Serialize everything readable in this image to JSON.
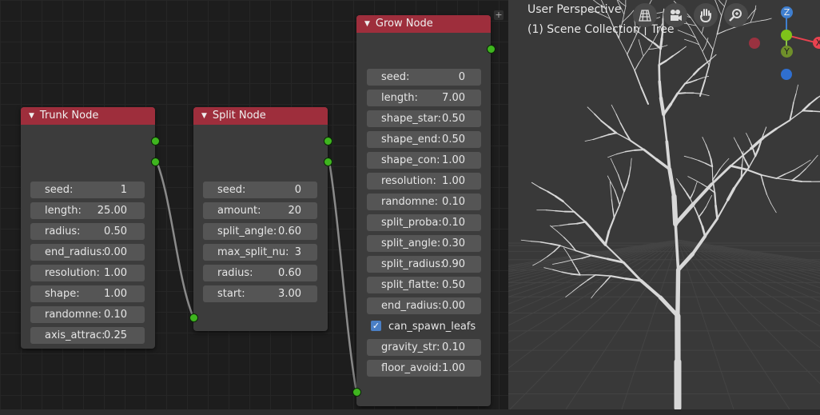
{
  "nodes": {
    "trunk": {
      "title": "Trunk Node",
      "fields": [
        {
          "label": "seed:",
          "value": "1"
        },
        {
          "label": "length:",
          "value": "25.00"
        },
        {
          "label": "radius:",
          "value": "0.50"
        },
        {
          "label": "end_radius:",
          "value": "0.00"
        },
        {
          "label": "resolution:",
          "value": "1.00"
        },
        {
          "label": "shape:",
          "value": "1.00"
        },
        {
          "label": "randomne:",
          "value": "0.10"
        },
        {
          "label": "axis_attrac:",
          "value": "0.25"
        }
      ]
    },
    "split": {
      "title": "Split Node",
      "fields": [
        {
          "label": "seed:",
          "value": "0"
        },
        {
          "label": "amount:",
          "value": "20"
        },
        {
          "label": "split_angle:",
          "value": "0.60"
        },
        {
          "label": "max_split_nu:",
          "value": "3"
        },
        {
          "label": "radius:",
          "value": "0.60"
        },
        {
          "label": "start:",
          "value": "3.00"
        }
      ]
    },
    "grow": {
      "title": "Grow Node",
      "fields": [
        {
          "label": "seed:",
          "value": "0"
        },
        {
          "label": "length:",
          "value": "7.00"
        },
        {
          "label": "shape_star:",
          "value": "0.50"
        },
        {
          "label": "shape_end:",
          "value": "0.50"
        },
        {
          "label": "shape_con:",
          "value": "1.00"
        },
        {
          "label": "resolution:",
          "value": "1.00"
        },
        {
          "label": "randomne:",
          "value": "0.10"
        },
        {
          "label": "split_proba:",
          "value": "0.10"
        },
        {
          "label": "split_angle:",
          "value": "0.30"
        },
        {
          "label": "split_radius:",
          "value": "0.90"
        },
        {
          "label": "split_flatte:",
          "value": "0.50"
        },
        {
          "label": "end_radius:",
          "value": "0.00"
        }
      ],
      "checkbox": {
        "label": "can_spawn_leafs",
        "checked": true
      },
      "fields_after": [
        {
          "label": "gravity_str:",
          "value": "0.10"
        },
        {
          "label": "floor_avoid:",
          "value": "1.00"
        }
      ]
    }
  },
  "viewport": {
    "view_name": "User Perspective",
    "collection": "(1) Scene Collection | Tree",
    "nav_buttons": [
      "grid-icon",
      "camera-icon",
      "hand-icon",
      "zoom-icon"
    ],
    "gizmo": {
      "z": "Z",
      "y": "Y",
      "x": "X"
    }
  },
  "colors": {
    "node_header": "#9e2e3c",
    "socket": "#3fb51f",
    "gizmo_x": "#e8424f",
    "gizmo_y": "#8bc34a",
    "gizmo_z": "#3f7fd0"
  }
}
